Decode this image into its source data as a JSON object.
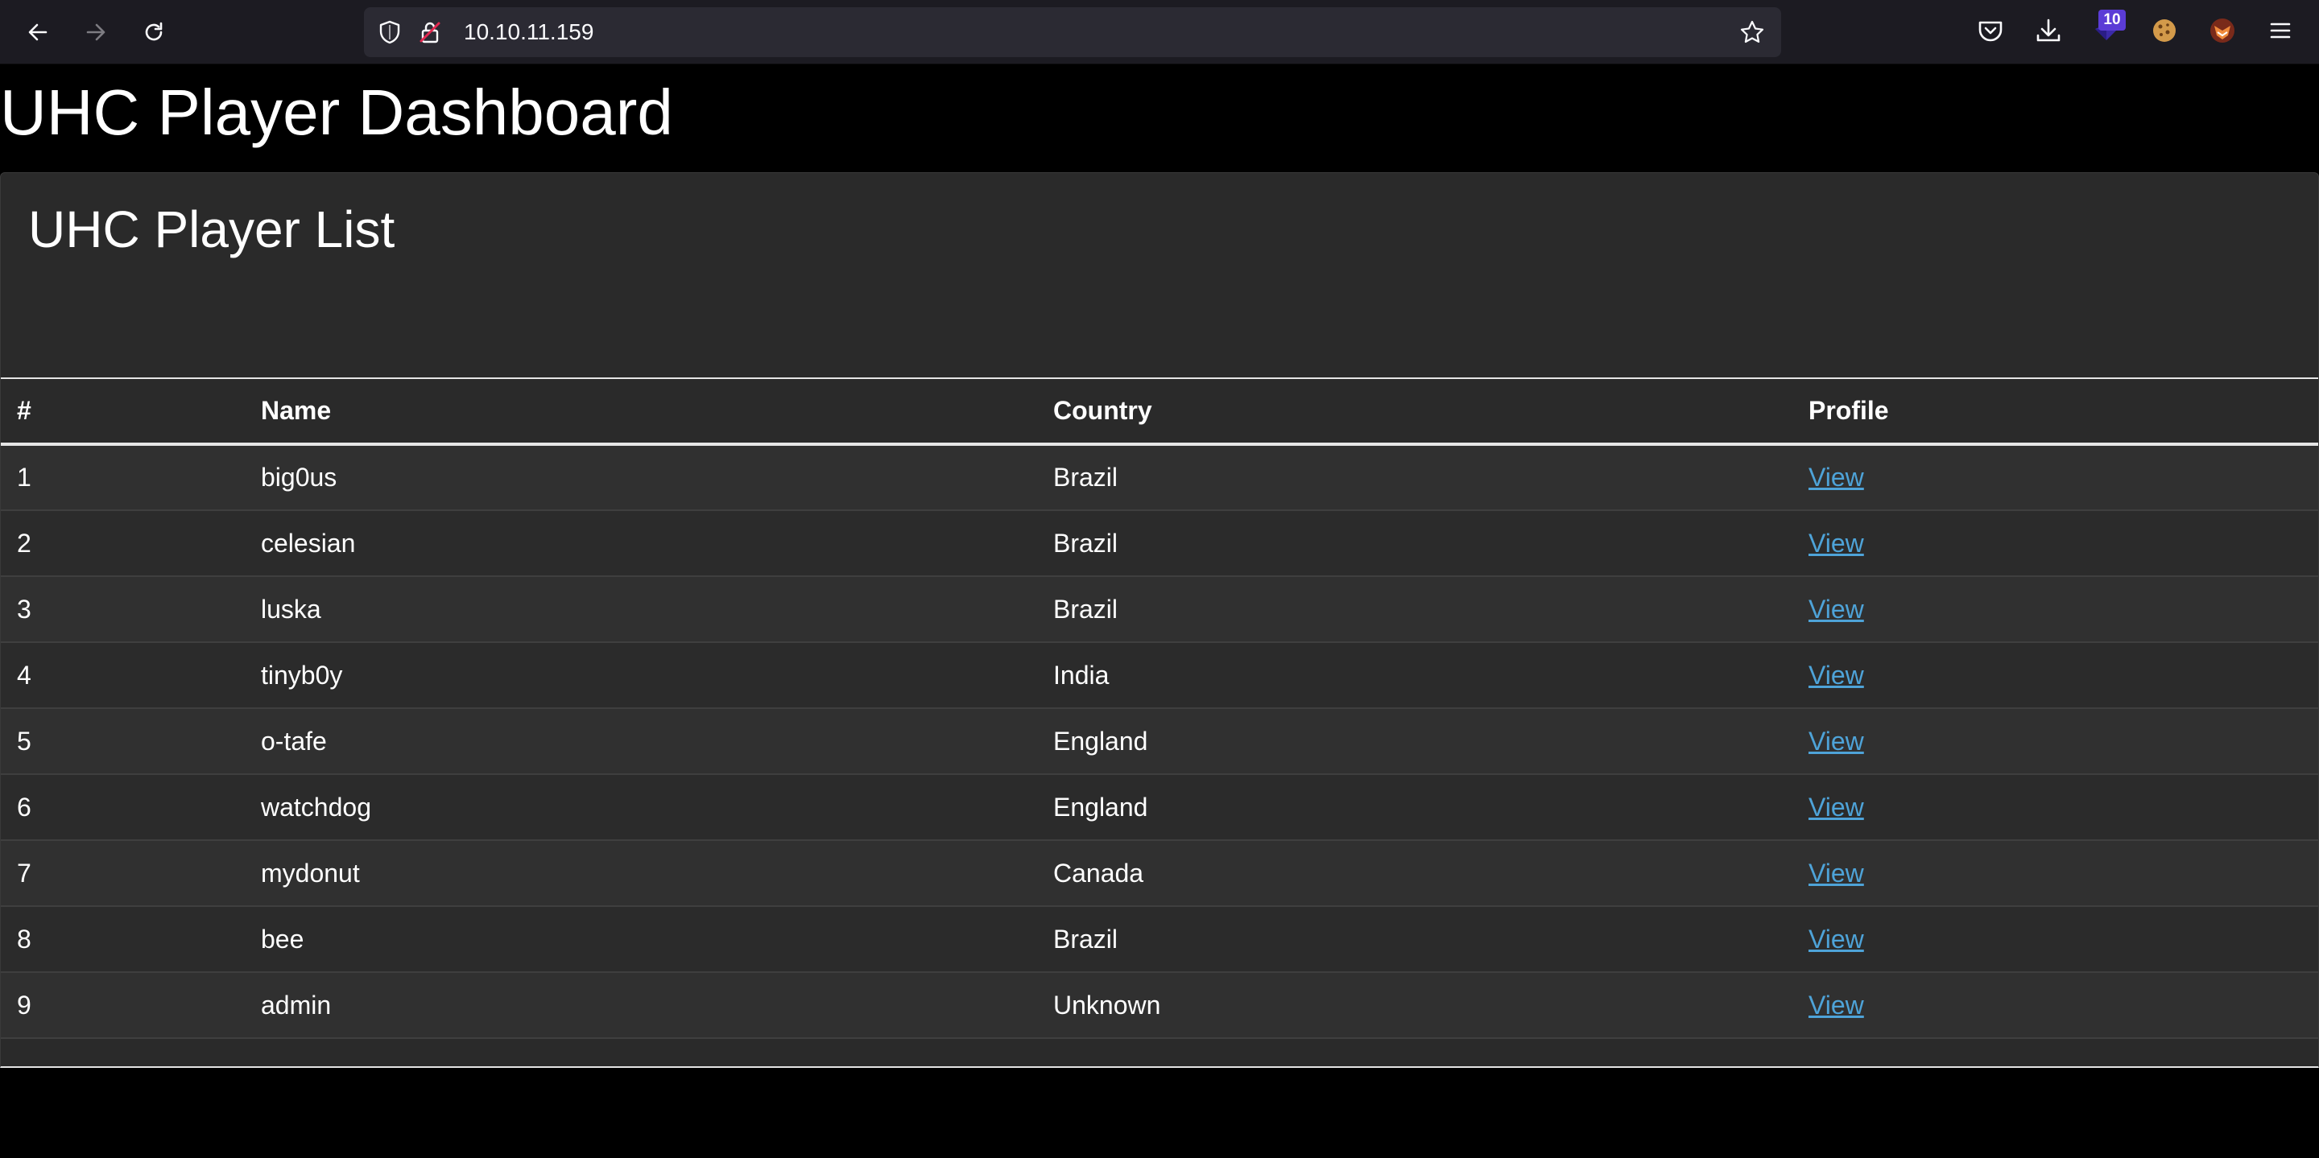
{
  "browser": {
    "url": "10.10.11.159",
    "extension_badge": "10"
  },
  "page": {
    "title": "UHC Player Dashboard",
    "card_title": "UHC Player List"
  },
  "table": {
    "headers": [
      "#",
      "Name",
      "Country",
      "Profile"
    ],
    "rows": [
      {
        "num": "1",
        "name": "big0us",
        "country": "Brazil",
        "profile": "View"
      },
      {
        "num": "2",
        "name": "celesian",
        "country": "Brazil",
        "profile": "View"
      },
      {
        "num": "3",
        "name": "luska",
        "country": "Brazil",
        "profile": "View"
      },
      {
        "num": "4",
        "name": "tinyb0y",
        "country": "India",
        "profile": "View"
      },
      {
        "num": "5",
        "name": "o-tafe",
        "country": "England",
        "profile": "View"
      },
      {
        "num": "6",
        "name": "watchdog",
        "country": "England",
        "profile": "View"
      },
      {
        "num": "7",
        "name": "mydonut",
        "country": "Canada",
        "profile": "View"
      },
      {
        "num": "8",
        "name": "bee",
        "country": "Brazil",
        "profile": "View"
      },
      {
        "num": "9",
        "name": "admin",
        "country": "Unknown",
        "profile": "View"
      }
    ]
  },
  "icons": {
    "back": "arrow-left-icon",
    "forward": "arrow-right-icon",
    "reload": "reload-icon",
    "shield": "shield-icon",
    "insecure_lock": "insecure-lock-icon",
    "bookmark": "star-icon",
    "pocket": "pocket-icon",
    "downloads": "download-icon",
    "extension": "extension-icon",
    "cookie": "cookie-icon",
    "avatar": "fox-avatar-icon",
    "menu": "hamburger-menu-icon"
  },
  "colors": {
    "link": "#4ea3d8",
    "card_bg": "#2a2a2a",
    "toolbar_bg": "#1c1b22"
  }
}
